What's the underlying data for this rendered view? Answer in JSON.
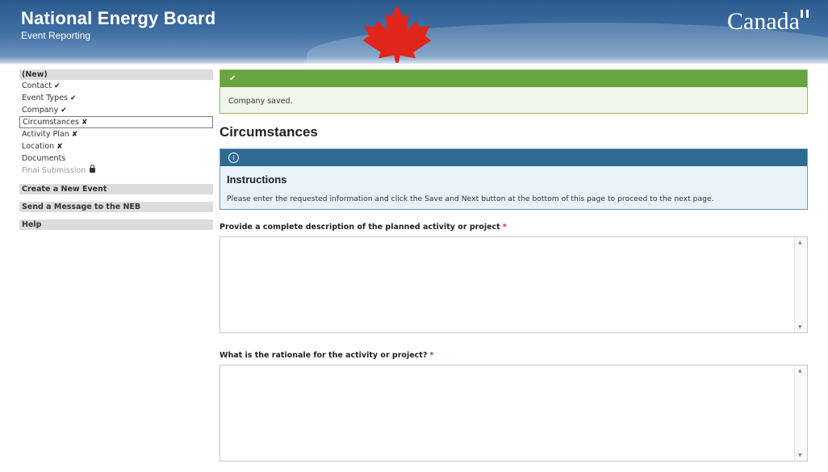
{
  "header": {
    "title": "National Energy Board",
    "subtitle": "Event Reporting",
    "wordmark": "Canada"
  },
  "sidebar": {
    "heading": "(New)",
    "steps": [
      {
        "label": "Contact",
        "status": "check"
      },
      {
        "label": "Event Types",
        "status": "check"
      },
      {
        "label": "Company",
        "status": "check"
      },
      {
        "label": "Circumstances",
        "status": "cross",
        "active": true
      },
      {
        "label": "Activity Plan",
        "status": "cross"
      },
      {
        "label": "Location",
        "status": "cross"
      },
      {
        "label": "Documents",
        "status": "none"
      },
      {
        "label": "Final Submission",
        "status": "locked",
        "disabled": true
      }
    ],
    "marks": {
      "check": "✔",
      "cross": "✘"
    },
    "links": [
      "Create a New Event",
      "Send a Message to the NEB",
      "Help"
    ]
  },
  "alert_success": {
    "icon": "check-icon",
    "message": "Company saved."
  },
  "page_title": "Circumstances",
  "instructions": {
    "icon": "info-icon",
    "title": "Instructions",
    "text": "Please enter the requested information and click the Save and Next button at the bottom of this page to proceed to the next page."
  },
  "questions": [
    {
      "label": "Provide a complete description of the planned activity or project",
      "required_mark": "*",
      "value": ""
    },
    {
      "label": "What is the rationale for the activity or project?",
      "required_mark": "*",
      "value": ""
    }
  ],
  "colors": {
    "header_blue": "#2c5a8f",
    "success_green": "#6aa341",
    "info_blue": "#2d6a94",
    "required_red": "#d62a2a"
  }
}
